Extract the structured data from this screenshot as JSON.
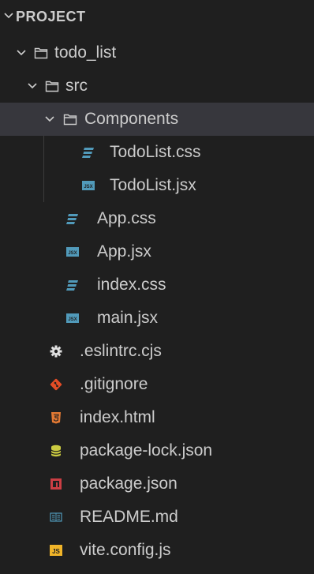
{
  "explorer": {
    "section_title": "PROJECT",
    "items": [
      {
        "label": "todo_list",
        "kind": "folder",
        "icon": "folder-icon"
      },
      {
        "label": "src",
        "kind": "folder",
        "icon": "folder-icon"
      },
      {
        "label": "Components",
        "kind": "folder",
        "icon": "folder-icon",
        "selected": true
      },
      {
        "label": "TodoList.css",
        "kind": "file",
        "icon": "css-icon"
      },
      {
        "label": "TodoList.jsx",
        "kind": "file",
        "icon": "jsx-icon",
        "badge": "JSX"
      },
      {
        "label": "App.css",
        "kind": "file",
        "icon": "css-icon"
      },
      {
        "label": "App.jsx",
        "kind": "file",
        "icon": "jsx-icon",
        "badge": "JSX"
      },
      {
        "label": "index.css",
        "kind": "file",
        "icon": "css-icon"
      },
      {
        "label": "main.jsx",
        "kind": "file",
        "icon": "jsx-icon",
        "badge": "JSX"
      },
      {
        "label": ".eslintrc.cjs",
        "kind": "file",
        "icon": "gear-icon"
      },
      {
        "label": ".gitignore",
        "kind": "file",
        "icon": "git-icon"
      },
      {
        "label": "index.html",
        "kind": "file",
        "icon": "html5-icon"
      },
      {
        "label": "package-lock.json",
        "kind": "file",
        "icon": "lock-db-icon"
      },
      {
        "label": "package.json",
        "kind": "file",
        "icon": "npm-icon"
      },
      {
        "label": "README.md",
        "kind": "file",
        "icon": "readme-icon"
      },
      {
        "label": "vite.config.js",
        "kind": "file",
        "icon": "js-icon",
        "badge": "JS"
      }
    ]
  },
  "colors": {
    "background": "#1f1f1f",
    "selected_row": "#37373d",
    "text": "#cccccc",
    "css_blue": "#519aba",
    "jsx_blue": "#519aba",
    "git_red": "#e44d26",
    "html_orange": "#e37933",
    "lock_yellow": "#cbcb41",
    "npm_red": "#cc3e44",
    "js_yellow": "#f0b429"
  }
}
